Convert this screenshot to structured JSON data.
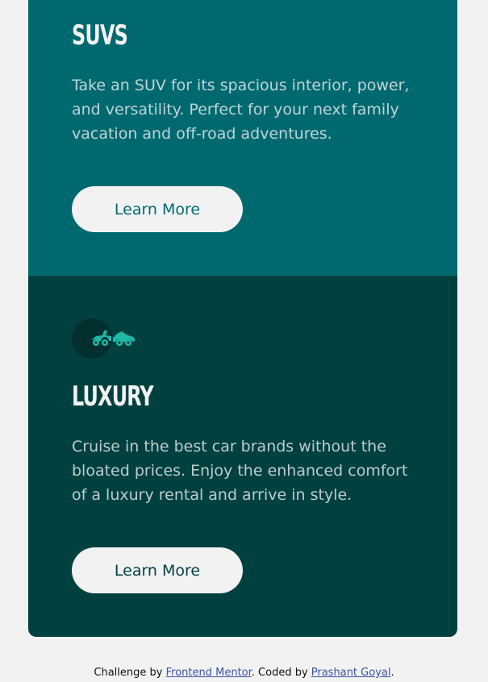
{
  "cards": {
    "suvs": {
      "title": "SUVs",
      "description": "Take an SUV for its spacious interior, power, and versatility. Perfect for your next family vacation and off-road adventures.",
      "button_label": "Learn More",
      "background": "#006970"
    },
    "luxury": {
      "icon": "luxury-car-icon",
      "title": "Luxury",
      "description": "Cruise in the best car brands without the bloated prices. Enjoy the enhanced comfort of a luxury rental and arrive in style.",
      "button_label": "Learn More",
      "background": "#004140",
      "icon_color": "#20b8a8"
    }
  },
  "footer": {
    "prefix": "Challenge by ",
    "link1": "Frontend Mentor",
    "middle": ". Coded by ",
    "link2": "Prashant Goyal",
    "suffix": "."
  }
}
